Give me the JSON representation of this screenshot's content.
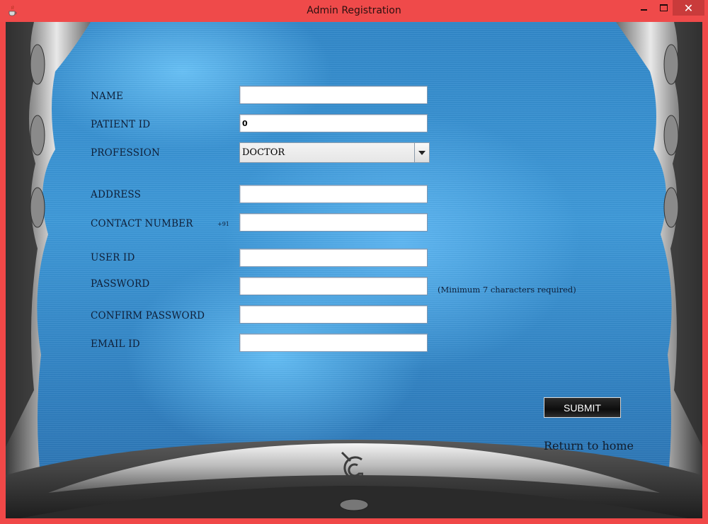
{
  "window": {
    "title": "Admin Registration",
    "close_glyph": "✕",
    "icons": {
      "app": "java-cup-icon",
      "minimize": "minimize-icon",
      "maximize": "maximize-icon",
      "close": "close-icon"
    }
  },
  "form": {
    "name": {
      "label": "NAME",
      "value": ""
    },
    "patient_id": {
      "label": "PATIENT ID",
      "value": "0"
    },
    "profession": {
      "label": "PROFESSION",
      "selected": "DOCTOR"
    },
    "address": {
      "label": "ADDRESS",
      "value": ""
    },
    "contact_number": {
      "label": "CONTACT NUMBER",
      "prefix": "+91",
      "value": ""
    },
    "user_id": {
      "label": "USER ID",
      "value": ""
    },
    "password": {
      "label": "PASSWORD",
      "value": "",
      "hint": "(Minimum 7 characters required)"
    },
    "confirm_password": {
      "label": "CONFIRM PASSWORD",
      "value": ""
    },
    "email_id": {
      "label": "EMAIL ID",
      "value": ""
    }
  },
  "actions": {
    "submit_label": "SUBMIT",
    "return_link": "Return to home"
  },
  "colors": {
    "titlebar": "#ef4a4a",
    "close_button": "#c93b3b",
    "panel_blue": "#3c98d8",
    "label_text": "#0f1f38"
  }
}
